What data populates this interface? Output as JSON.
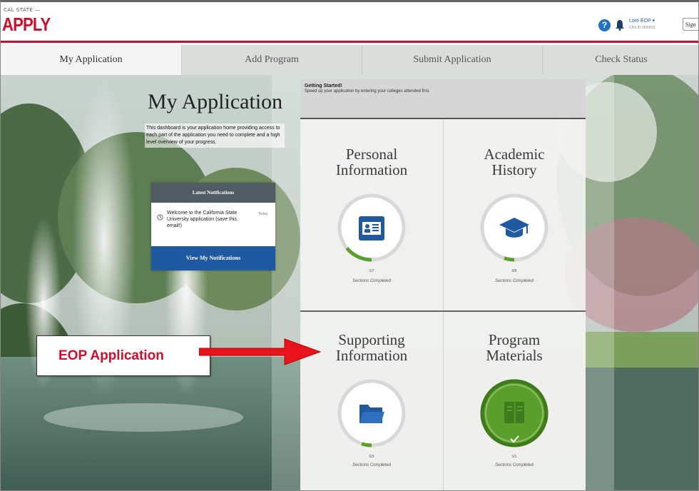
{
  "header": {
    "logo_small": "CAL STATE —",
    "logo_main": "APPLY",
    "user_name": "Lore EOP ▾",
    "user_sub": "CAS ID 9999911",
    "sign_label": "Sign"
  },
  "tabs": [
    {
      "label": "My Application",
      "active": true
    },
    {
      "label": "Add Program",
      "active": false
    },
    {
      "label": "Submit Application",
      "active": false
    },
    {
      "label": "Check Status",
      "active": false
    }
  ],
  "intro": {
    "title": "My Application",
    "text": "This dashboard is your application home providing access to each part of the application you need to complete and a high level overview of your progress."
  },
  "notifications": {
    "heading": "Latest Notifications",
    "item_text": "Welcome to the California State University application (save this email!)",
    "item_time": "Today",
    "button_label": "View My Notifications"
  },
  "getting_started": {
    "title": "Getting Started!",
    "text": "Speed up your application by entering your colleges attended first."
  },
  "cards": [
    {
      "title_line1": "Personal",
      "title_line2": "Information",
      "count": "1/7",
      "label": "Sections Completed",
      "progress": 0.14,
      "completed": false,
      "icon": "id-card-icon"
    },
    {
      "title_line1": "Academic",
      "title_line2": "History",
      "count": "0/8",
      "label": "Sections Completed",
      "progress": 0.05,
      "completed": false,
      "icon": "graduation-cap-icon"
    },
    {
      "title_line1": "Supporting",
      "title_line2": "Information",
      "count": "0/3",
      "label": "Sections Completed",
      "progress": 0.05,
      "completed": false,
      "icon": "folder-icon"
    },
    {
      "title_line1": "Program",
      "title_line2": "Materials",
      "count": "1/1",
      "label": "Sections Completed",
      "progress": 1.0,
      "completed": true,
      "icon": "book-icon"
    }
  ],
  "callout": {
    "text": "EOP Application"
  },
  "colors": {
    "brand_red": "#c8102e",
    "primary_blue": "#1f5aa0",
    "complete_green": "#5a9e2b"
  }
}
